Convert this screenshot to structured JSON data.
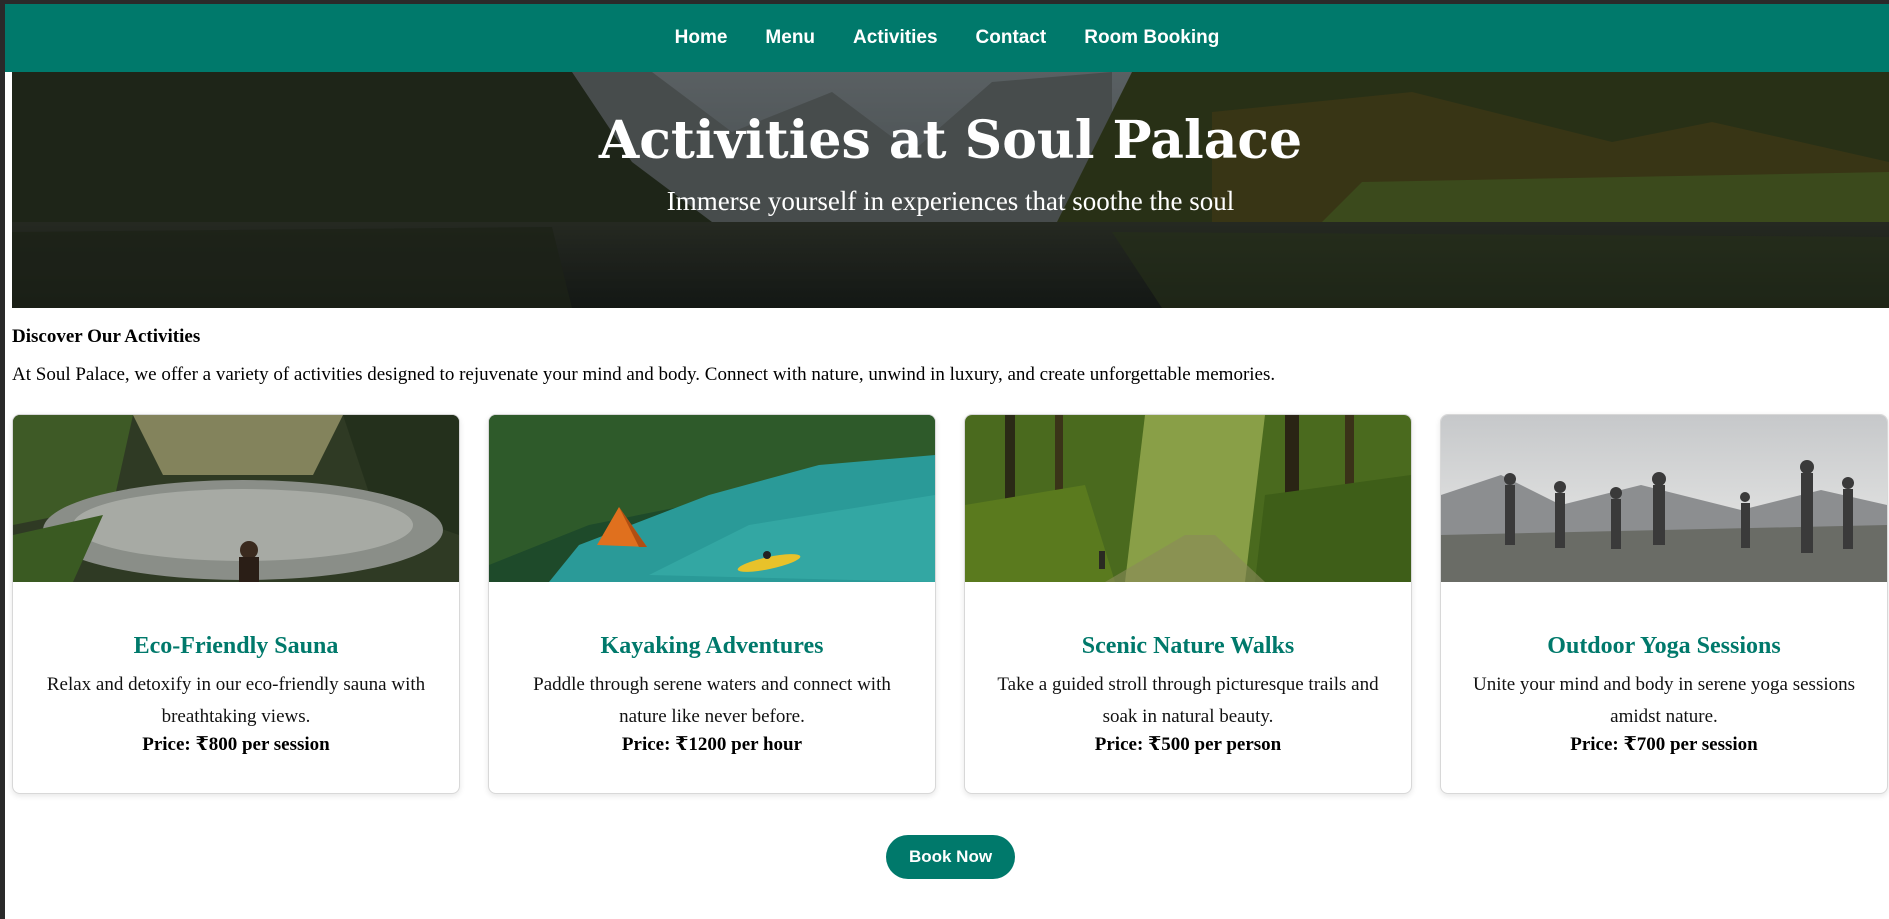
{
  "nav": {
    "items": [
      {
        "label": "Home"
      },
      {
        "label": "Menu"
      },
      {
        "label": "Activities"
      },
      {
        "label": "Contact"
      },
      {
        "label": "Room Booking"
      }
    ]
  },
  "hero": {
    "title": "Activities at Soul Palace",
    "subtitle": "Immerse yourself in experiences that soothe the soul"
  },
  "intro": {
    "heading": "Discover Our Activities",
    "text": "At Soul Palace, we offer a variety of activities designed to rejuvenate your mind and body. Connect with nature, unwind in luxury, and create unforgettable memories."
  },
  "activities": [
    {
      "title": "Eco-Friendly Sauna",
      "description": "Relax and detoxify in our eco-friendly sauna with breathtaking views.",
      "price": "Price: ₹800 per session"
    },
    {
      "title": "Kayaking Adventures",
      "description": "Paddle through serene waters and connect with nature like never before.",
      "price": "Price: ₹1200 per hour"
    },
    {
      "title": "Scenic Nature Walks",
      "description": "Take a guided stroll through picturesque trails and soak in natural beauty.",
      "price": "Price: ₹500 per person"
    },
    {
      "title": "Outdoor Yoga Sessions",
      "description": "Unite your mind and body in serene yoga sessions amidst nature.",
      "price": "Price: ₹700 per session"
    }
  ],
  "cta": {
    "label": "Book Now"
  },
  "colors": {
    "brand": "#00796b",
    "text": "#000000",
    "card_border": "#d8d8d8"
  }
}
